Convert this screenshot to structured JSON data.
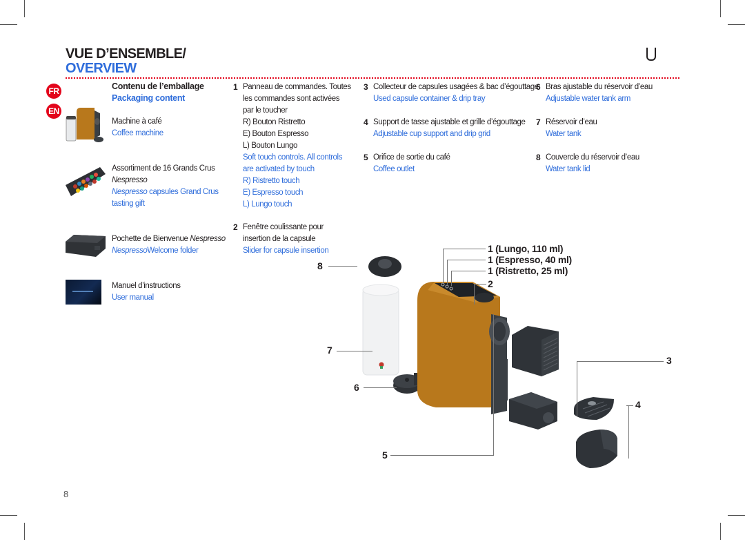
{
  "header": {
    "title_fr": "VUE D’ENSEMBLE/",
    "title_en": "OVERVIEW",
    "brand_glyph": "U"
  },
  "languages": [
    "FR",
    "EN"
  ],
  "colors": {
    "accent_red": "#e3051b",
    "english_blue": "#2f6ddb",
    "text": "#231f20",
    "machine_orange": "#b8781c",
    "part_dark": "#3a3f44"
  },
  "packaging": {
    "heading_fr": "Contenu de l’emballage",
    "heading_en": "Packaging content",
    "items": [
      {
        "icon": "coffee-machine-image",
        "fr": "Machine à café",
        "en": "Coffee machine"
      },
      {
        "icon": "capsule-box-image",
        "fr_main": "Assortiment de 16 Grands Crus",
        "fr_italic": "Nespresso",
        "en_italic": "Nespresso",
        "en_main": " capsules Grand Crus",
        "en_line2": "tasting gift"
      },
      {
        "icon": "welcome-folder-image",
        "fr_main": "Pochette de Bienvenue ",
        "fr_italic": "Nespresso",
        "en_italic": "Nespresso",
        "en_main": "Welcome folder"
      },
      {
        "icon": "user-manual-image",
        "fr": "Manuel d’instructions",
        "en": "User manual"
      }
    ]
  },
  "parts": [
    {
      "number": "1",
      "fr": [
        "Panneau de commandes. Toutes",
        "les commandes sont activées",
        "par le toucher",
        "R) Bouton Ristretto",
        "E) Bouton Espresso",
        "L) Bouton Lungo"
      ],
      "en": [
        "Soft touch controls. All controls",
        "are activated by touch",
        "R) Ristretto touch",
        "E) Espresso touch",
        "L) Lungo touch"
      ]
    },
    {
      "number": "2",
      "fr": [
        "Fenêtre coulissante pour",
        "insertion de la capsule"
      ],
      "en": [
        "Slider for capsule insertion"
      ]
    },
    {
      "number": "3",
      "fr": [
        "Collecteur de capsules usagées & bac d’égouttage"
      ],
      "en": [
        "Used capsule container & drip tray"
      ]
    },
    {
      "number": "4",
      "fr": [
        "Support de tasse ajustable et grille d’égouttage"
      ],
      "en": [
        "Adjustable cup support and drip grid"
      ]
    },
    {
      "number": "5",
      "fr": [
        "Orifice de sortie du café"
      ],
      "en": [
        "Coffee outlet"
      ]
    },
    {
      "number": "6",
      "fr": [
        "Bras ajustable du réservoir d’eau"
      ],
      "en": [
        "Adjustable water tank arm"
      ]
    },
    {
      "number": "7",
      "fr": [
        "Réservoir d’eau"
      ],
      "en": [
        "Water tank"
      ]
    },
    {
      "number": "8",
      "fr": [
        "Couvercle du réservoir d’eau"
      ],
      "en": [
        "Water tank lid"
      ]
    }
  ],
  "diagram": {
    "callouts": {
      "lungo": "1 (Lungo, 110 ml)",
      "espresso": "1 (Espresso, 40 ml)",
      "ristretto": "1 (Ristretto, 25 ml)",
      "c2": "2",
      "c3": "3",
      "c4": "4",
      "c5": "5",
      "c6": "6",
      "c7": "7",
      "c8": "8"
    }
  },
  "footer": {
    "page_number": "8"
  }
}
